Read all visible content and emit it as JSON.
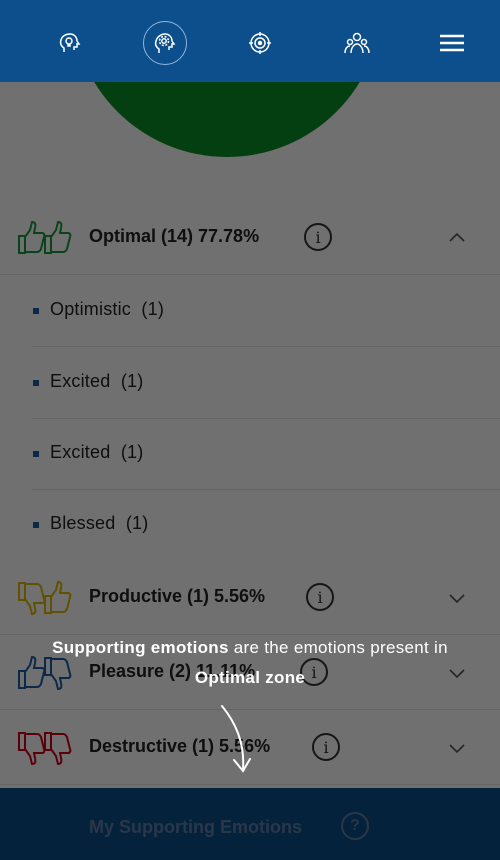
{
  "nav": {
    "items": [
      {
        "icon": "lightbulb-head-icon"
      },
      {
        "icon": "brain-gear-icon"
      },
      {
        "icon": "target-icon"
      },
      {
        "icon": "people-icon"
      },
      {
        "icon": "hamburger-menu-icon"
      }
    ]
  },
  "pie_color": "#0a8f2a",
  "zones": {
    "optimal": {
      "label": "Optimal (14) 77.78%",
      "color": "#1a9a3c",
      "icon": "two-thumbs-up-icon",
      "expanded": true
    },
    "productive": {
      "label": "Productive (1) 5.56%",
      "color": "#e0b800",
      "icon": "thumb-down-thumb-up-icon"
    },
    "pleasure": {
      "label": "Pleasure (2) 11.11%",
      "color": "#1d5fa8",
      "icon": "thumb-up-thumb-down-icon"
    },
    "destructive": {
      "label": "Destructive (1) 5.56%",
      "color": "#d0021b",
      "icon": "two-thumbs-down-icon"
    }
  },
  "optimal_emotions": [
    {
      "name": "Optimistic",
      "count": "(1)"
    },
    {
      "name": "Excited",
      "count": "(1)"
    },
    {
      "name": "Excited",
      "count": "(1)"
    },
    {
      "name": "Blessed",
      "count": "(1)"
    }
  ],
  "info_glyph": "i",
  "coach": {
    "bold1": "Supporting emotions",
    "text1": " are the emotions present in",
    "bold2": "Optimal zone"
  },
  "bottom": {
    "label": "My Supporting Emotions",
    "help_glyph": "?"
  }
}
